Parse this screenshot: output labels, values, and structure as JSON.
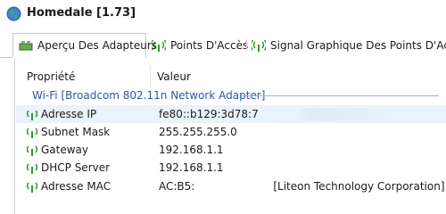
{
  "window": {
    "title": "Homedale [1.73]"
  },
  "tabs": [
    {
      "label": "Aperçu Des Adapteurs",
      "active": true,
      "icon": "network-adapter-icon"
    },
    {
      "label": "Points D'Accès",
      "active": false,
      "icon": "wifi-signal-icon"
    },
    {
      "label": "Signal Graphique Des Points D'Accès",
      "active": false,
      "icon": "wifi-signal-icon"
    }
  ],
  "table": {
    "columns": [
      "Propriété",
      "Valeur"
    ],
    "group": "Wi-Fi [Broadcom 802.11n Network Adapter]",
    "rows": [
      {
        "label": "Adresse IP",
        "value": "fe80::b129:3d78:7",
        "selected": true
      },
      {
        "label": "Subnet Mask",
        "value": "255.255.255.0"
      },
      {
        "label": "Gateway",
        "value": "192.168.1.1"
      },
      {
        "label": "DHCP Server",
        "value": "192.168.1.1"
      },
      {
        "label": "Adresse MAC",
        "value_prefix": "AC:B5:",
        "value_suffix": "[Liteon Technology Corporation]"
      }
    ]
  },
  "colors": {
    "accent_green": "#2e9b2e",
    "group_text": "#2a56b0",
    "selection": "#eaf3fb"
  }
}
